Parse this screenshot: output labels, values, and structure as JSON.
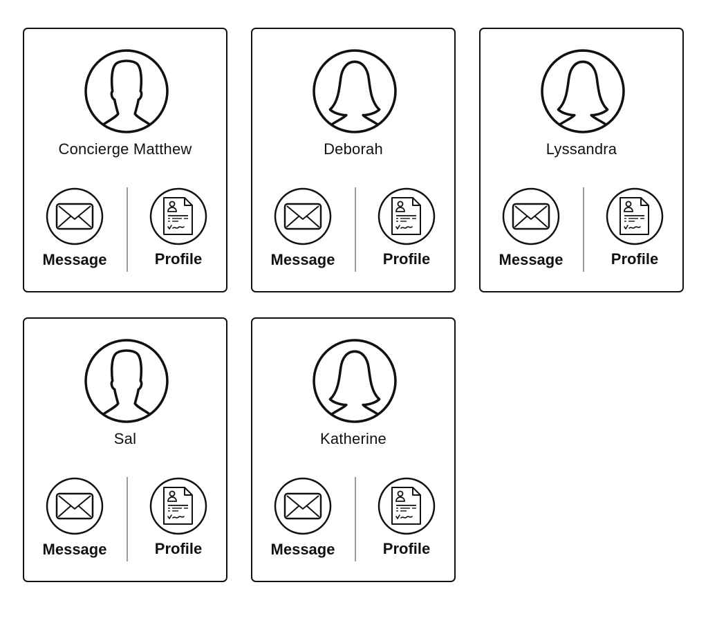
{
  "contacts": [
    {
      "name": "Concierge Matthew",
      "avatar": "male-silhouette-icon",
      "message_label": "Message",
      "profile_label": "Profile"
    },
    {
      "name": "Deborah",
      "avatar": "female-silhouette-icon",
      "message_label": "Message",
      "profile_label": "Profile"
    },
    {
      "name": "Lyssandra",
      "avatar": "female-silhouette-icon",
      "message_label": "Message",
      "profile_label": "Profile"
    },
    {
      "name": "Sal",
      "avatar": "male-silhouette-icon",
      "message_label": "Message",
      "profile_label": "Profile"
    },
    {
      "name": "Katherine",
      "avatar": "female-silhouette-icon",
      "message_label": "Message",
      "profile_label": "Profile"
    }
  ],
  "colors": {
    "stroke": "#111111",
    "divider": "#9b9b9b",
    "background": "#ffffff"
  },
  "icons": {
    "message": "envelope-icon",
    "profile": "resume-document-icon"
  }
}
